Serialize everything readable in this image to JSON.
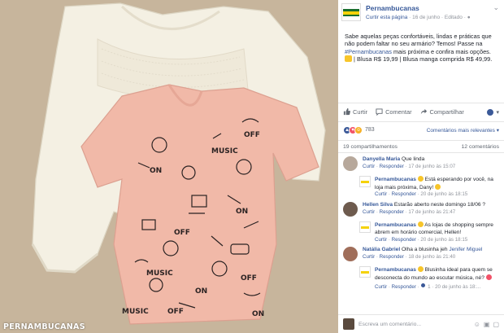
{
  "post": {
    "page_name": "Pernambucanas",
    "follow_label": "Curtir esta página",
    "date": "16 de junho",
    "edited_label": "Editado",
    "text_before_hashtag": "Sabe aquelas peças confortáveis, lindas e práticas que não podem faltar no seu armário? Temos! Passe na ",
    "hashtag": "#Pernambucanas",
    "text_after_hashtag": " mais próxima e confira mais opções.",
    "text_after_emoji": " | Blusa R$ 19,99 | Blusa manga comprida R$ 49,99.",
    "watermark": "PERNAMBUCANAS"
  },
  "actions": {
    "like": "Curtir",
    "comment": "Comentar",
    "share": "Compartilhar"
  },
  "reactions": {
    "count": "783",
    "relevance_label": "Comentários mais relevantes",
    "shares": "19 compartilhamentos",
    "comments_count": "12 comentários"
  },
  "comments": [
    {
      "author": "Danyella Maria",
      "text": "Que linda",
      "like": "Curtir",
      "reply": "Responder",
      "time": "17 de junho às 15:07"
    },
    {
      "author": "Pernambucanas",
      "text": "Está esperando por você, na loja mais próxima, Dany!",
      "like": "Curtir",
      "reply": "Responder",
      "time": "20 de junho às 18:15"
    },
    {
      "author": "Hellen Silva",
      "text": "Estarão aberto neste domingo 18/06 ?",
      "like": "Curtir",
      "reply": "Responder",
      "time": "17 de junho às 21:47"
    },
    {
      "author": "Pernambucanas",
      "text": "As lojas de shopping sempre abrem em horário comercial, Hellen!",
      "like": "Curtir",
      "reply": "Responder",
      "time": "20 de junho às 18:15"
    },
    {
      "author": "Natália Gabriel",
      "text": "Olha a blusinha jeh",
      "mention": "Jenifer Miguel",
      "like": "Curtir",
      "reply": "Responder",
      "time": "18 de junho às 21:40"
    },
    {
      "author": "Pernambucanas",
      "text": "Blusinha ideal para quem se desconecta do mundo ao escutar música, né?",
      "like": "Curtir",
      "reply": "Responder",
      "reactions_count": "1",
      "time": "20 de junho às 18:..."
    }
  ],
  "composer": {
    "placeholder": "Escreva um comentário..."
  },
  "colors": {
    "link": "#365899",
    "shirt_pink": "#f1b9a8",
    "sweater_cream": "#f4f0e3",
    "background_linen": "#c9b8a0"
  }
}
